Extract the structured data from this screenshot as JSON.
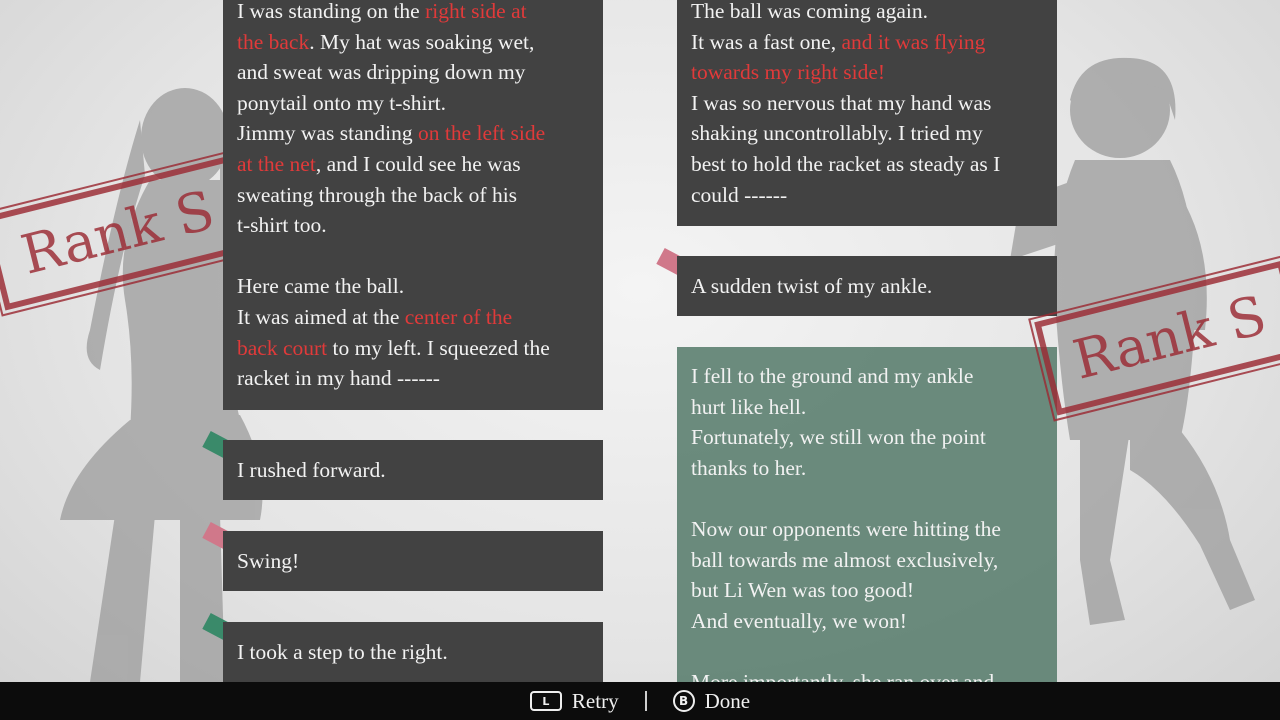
{
  "stamps": {
    "left": "Rank S",
    "right": "Rank S"
  },
  "left_column": {
    "main_card": {
      "lines": [
        [
          {
            "t": "I was standing on the "
          },
          {
            "t": "right side at",
            "hl": true
          }
        ],
        [
          {
            "t": "the back",
            "hl": true
          },
          {
            "t": ". My hat was soaking wet,"
          }
        ],
        [
          {
            "t": "and sweat was dripping down my"
          }
        ],
        [
          {
            "t": "ponytail onto my t-shirt."
          }
        ],
        [
          {
            "t": "Jimmy was standing "
          },
          {
            "t": "on the left side",
            "hl": true
          }
        ],
        [
          {
            "t": "at the net",
            "hl": true
          },
          {
            "t": ", and I could see he was"
          }
        ],
        [
          {
            "t": "sweating through the back of his"
          }
        ],
        [
          {
            "t": "t-shirt too."
          }
        ],
        [],
        [
          {
            "t": "Here came the ball."
          }
        ],
        [
          {
            "t": "It was aimed at the "
          },
          {
            "t": "center of the",
            "hl": true
          }
        ],
        [
          {
            "t": "back court",
            "hl": true
          },
          {
            "t": " to my left. I squeezed the"
          }
        ],
        [
          {
            "t": "racket in my hand ------"
          }
        ]
      ]
    },
    "choices": [
      {
        "text": "I rushed forward.",
        "tag": "green"
      },
      {
        "text": "Swing!",
        "tag": "pink"
      },
      {
        "text": "I took a step to the right.",
        "tag": "green"
      }
    ]
  },
  "right_column": {
    "top_card": {
      "lines": [
        [
          {
            "t": "The ball was coming again."
          }
        ],
        [
          {
            "t": "It was a fast one, "
          },
          {
            "t": "and it was flying",
            "hl": true
          }
        ],
        [
          {
            "t": "towards my right side!",
            "hl": true
          }
        ],
        [
          {
            "t": "I was so nervous that my hand was"
          }
        ],
        [
          {
            "t": "shaking uncontrollably. I tried my"
          }
        ],
        [
          {
            "t": "best to hold the racket as steady as I"
          }
        ],
        [
          {
            "t": "could ------"
          }
        ]
      ]
    },
    "choice": {
      "text": "A sudden twist of my ankle.",
      "tag": "pink"
    },
    "result_card": {
      "lines": [
        [
          {
            "t": "I fell to the ground and my ankle"
          }
        ],
        [
          {
            "t": "hurt like hell."
          }
        ],
        [
          {
            "t": "Fortunately, we still won the point"
          }
        ],
        [
          {
            "t": "thanks to her."
          }
        ],
        [],
        [
          {
            "t": "Now our opponents were hitting the"
          }
        ],
        [
          {
            "t": "ball towards me almost exclusively,"
          }
        ],
        [
          {
            "t": "but Li Wen was too good!"
          }
        ],
        [
          {
            "t": "And eventually, we won!"
          }
        ],
        [],
        [
          {
            "t": "More importantly, she ran over and"
          }
        ]
      ]
    }
  },
  "bottom_bar": {
    "retry_key": "L",
    "retry_label": "Retry",
    "done_key": "B",
    "done_label": "Done"
  }
}
